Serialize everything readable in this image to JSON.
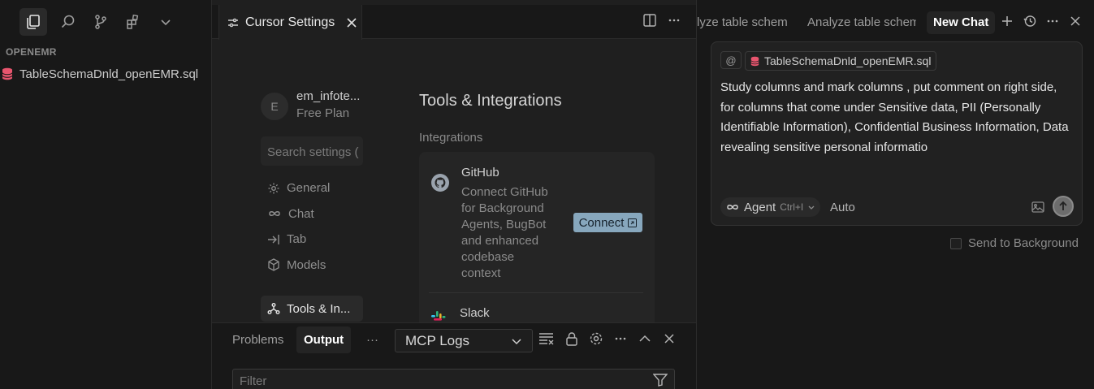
{
  "sidebar": {
    "section_title": "OPENEMR",
    "file_name": "TableSchemaDnld_openEMR.sql",
    "toolbar_icons": [
      "files-icon",
      "search-icon",
      "source-control-icon",
      "extensions-icon",
      "chevron-down-icon"
    ]
  },
  "editor": {
    "tab_title": "Cursor Settings",
    "profile": {
      "initial": "E",
      "name": "em_infote...",
      "plan": "Free Plan"
    },
    "search_placeholder": "Search settings (",
    "nav": [
      {
        "label": "General",
        "icon": "gear-icon"
      },
      {
        "label": "Chat",
        "icon": "infinity-icon"
      },
      {
        "label": "Tab",
        "icon": "arrow-tab-icon"
      },
      {
        "label": "Models",
        "icon": "cube-icon"
      },
      {
        "label": "Tools & In...",
        "icon": "tools-icon"
      }
    ],
    "main": {
      "title": "Tools & Integrations",
      "subtitle": "Integrations",
      "github": {
        "title": "GitHub",
        "description": "Connect GitHub for Background Agents, BugBot and enhanced codebase context",
        "button": "Connect"
      },
      "slack": {
        "title": "Slack"
      }
    }
  },
  "panel": {
    "tabs": {
      "problems": "Problems",
      "output": "Output",
      "more": "···"
    },
    "select_value": "MCP Logs",
    "filter_placeholder": "Filter"
  },
  "chat": {
    "tabs": [
      "lyze table schem",
      "Analyze table schem",
      "New Chat"
    ],
    "file_chip": "TableSchemaDnld_openEMR.sql",
    "at_symbol": "@",
    "prompt": "Study columns and mark columns , put comment on right side, for columns that come under Sensitive data, PII (Personally Identifiable Information), Confidential Business Information, Data revealing sensitive personal informatio",
    "mode_label": "Agent",
    "mode_shortcut": "Ctrl+I",
    "model_label": "Auto",
    "background_label": "Send to Background"
  },
  "colors": {
    "accent_button": "#87a7bd",
    "sql_file_icon": "#e8556e",
    "background": "#181818"
  }
}
